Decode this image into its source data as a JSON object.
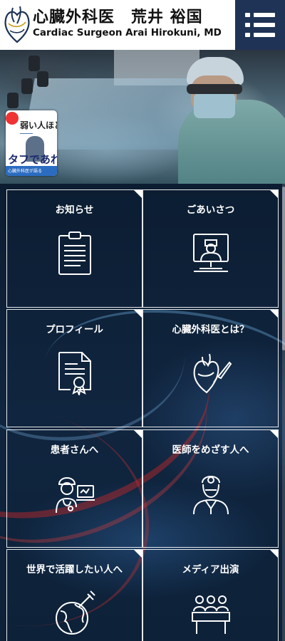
{
  "header": {
    "title_jp": "心臓外科医　荒井 裕国",
    "title_en": "Cardiac Surgeon  Arai Hirokuni, MD",
    "menu_icon": "hamburger-menu-icon"
  },
  "hero": {
    "book_title_top": "弱い人ほど",
    "book_title_bottom": "タフであれ",
    "book_band_text": "心臓外科医が語る"
  },
  "tiles": [
    {
      "label": "お知らせ",
      "icon": "clipboard-icon"
    },
    {
      "label": "ごあいさつ",
      "icon": "doctor-monitor-icon"
    },
    {
      "label": "プロフィール",
      "icon": "certificate-icon"
    },
    {
      "label": "心臓外科医とは？",
      "icon": "heart-scalpel-icon"
    },
    {
      "label": "患者さんへ",
      "icon": "nurse-laptop-icon"
    },
    {
      "label": "医師をめざす人へ",
      "icon": "doctor-headlamp-icon"
    },
    {
      "label": "世界で活躍したい人へ",
      "icon": "globe-syringe-icon"
    },
    {
      "label": "メディア出演",
      "icon": "panel-audience-icon"
    }
  ],
  "colors": {
    "header_bg": "#ffffff",
    "menu_bg": "#1e3355",
    "grid_bg": "#0c1d32",
    "tile_border": "#ffffff"
  }
}
